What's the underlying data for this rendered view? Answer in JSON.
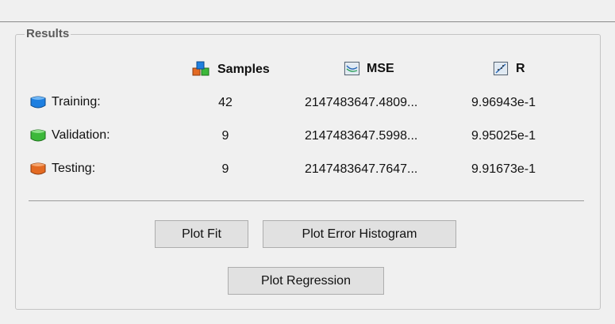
{
  "group_title": "Results",
  "columns": {
    "samples": "Samples",
    "mse": "MSE",
    "r": "R"
  },
  "rows": [
    {
      "label": "Training:",
      "samples": "42",
      "mse": "2147483647.4809...",
      "r": "9.96943e-1",
      "color": "#1e7fe0"
    },
    {
      "label": "Validation:",
      "samples": "9",
      "mse": "2147483647.5998...",
      "r": "9.95025e-1",
      "color": "#3cb83a"
    },
    {
      "label": "Testing:",
      "samples": "9",
      "mse": "2147483647.7647...",
      "r": "9.91673e-1",
      "color": "#e36a22"
    }
  ],
  "buttons": {
    "plot_fit": "Plot Fit",
    "plot_error_histogram": "Plot Error Histogram",
    "plot_regression": "Plot Regression"
  }
}
